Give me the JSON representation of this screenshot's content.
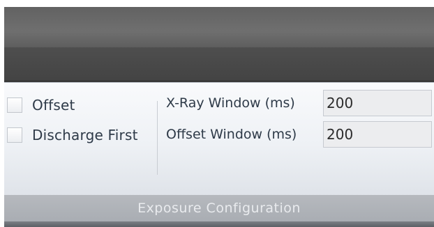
{
  "options": {
    "offset_label": "Offset",
    "discharge_first_label": "Discharge First"
  },
  "fields": {
    "xray_window": {
      "label": "X-Ray Window (ms)",
      "value": "200"
    },
    "offset_window": {
      "label": "Offset Window (ms)",
      "value": "200"
    }
  },
  "group": {
    "title": "Exposure Configuration"
  }
}
